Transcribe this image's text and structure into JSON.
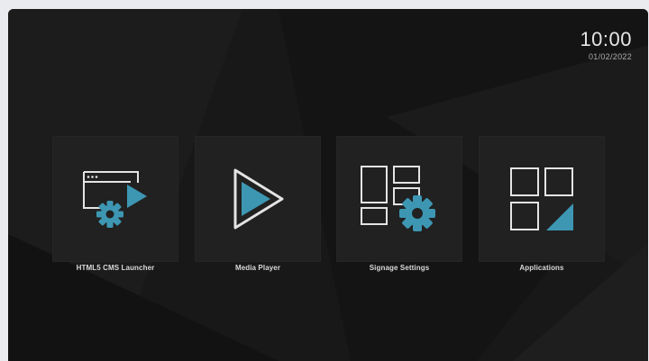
{
  "clock": {
    "time": "10:00",
    "date": "01/02/2022"
  },
  "apps": [
    {
      "label": "HTML5 CMS Launcher",
      "icon": "html5-cms-launcher-icon"
    },
    {
      "label": "Media Player",
      "icon": "play-icon"
    },
    {
      "label": "Signage Settings",
      "icon": "signage-settings-icon"
    },
    {
      "label": "Applications",
      "icon": "apps-grid-icon"
    }
  ],
  "colors": {
    "accent": "#3d97b3",
    "outline": "#e4e4e4",
    "background": "#181818",
    "tile": "#212121"
  }
}
